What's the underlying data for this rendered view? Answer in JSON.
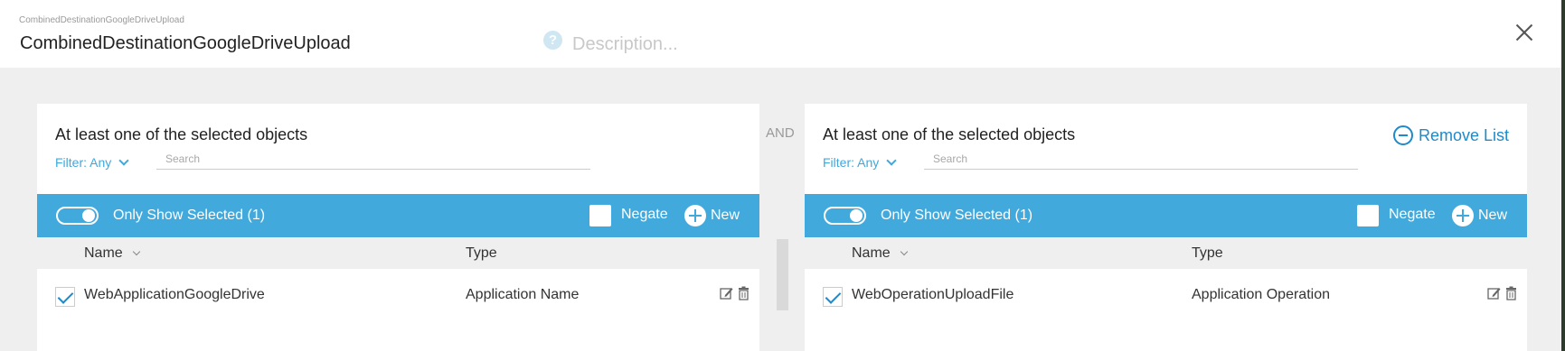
{
  "header": {
    "breadcrumb": "CombinedDestinationGoogleDriveUpload",
    "title": "CombinedDestinationGoogleDriveUpload",
    "description_placeholder": "Description..."
  },
  "connector": "AND",
  "lists": [
    {
      "title": "At least one of the selected objects",
      "filter_label": "Filter: Any",
      "search_placeholder": "Search",
      "only_show_selected": "Only Show Selected (1)",
      "negate_label": "Negate",
      "new_label": "New",
      "columns": {
        "name": "Name",
        "type": "Type"
      },
      "rows": [
        {
          "name": "WebApplicationGoogleDrive",
          "type": "Application Name",
          "checked": true
        }
      ]
    },
    {
      "title": "At least one of the selected objects",
      "remove_label": "Remove List",
      "filter_label": "Filter: Any",
      "search_placeholder": "Search",
      "only_show_selected": "Only Show Selected (1)",
      "negate_label": "Negate",
      "new_label": "New",
      "columns": {
        "name": "Name",
        "type": "Type"
      },
      "rows": [
        {
          "name": "WebOperationUploadFile",
          "type": "Application Operation",
          "checked": true
        }
      ]
    }
  ],
  "colors": {
    "accent": "#42a9dd",
    "link": "#1e8ac9"
  }
}
